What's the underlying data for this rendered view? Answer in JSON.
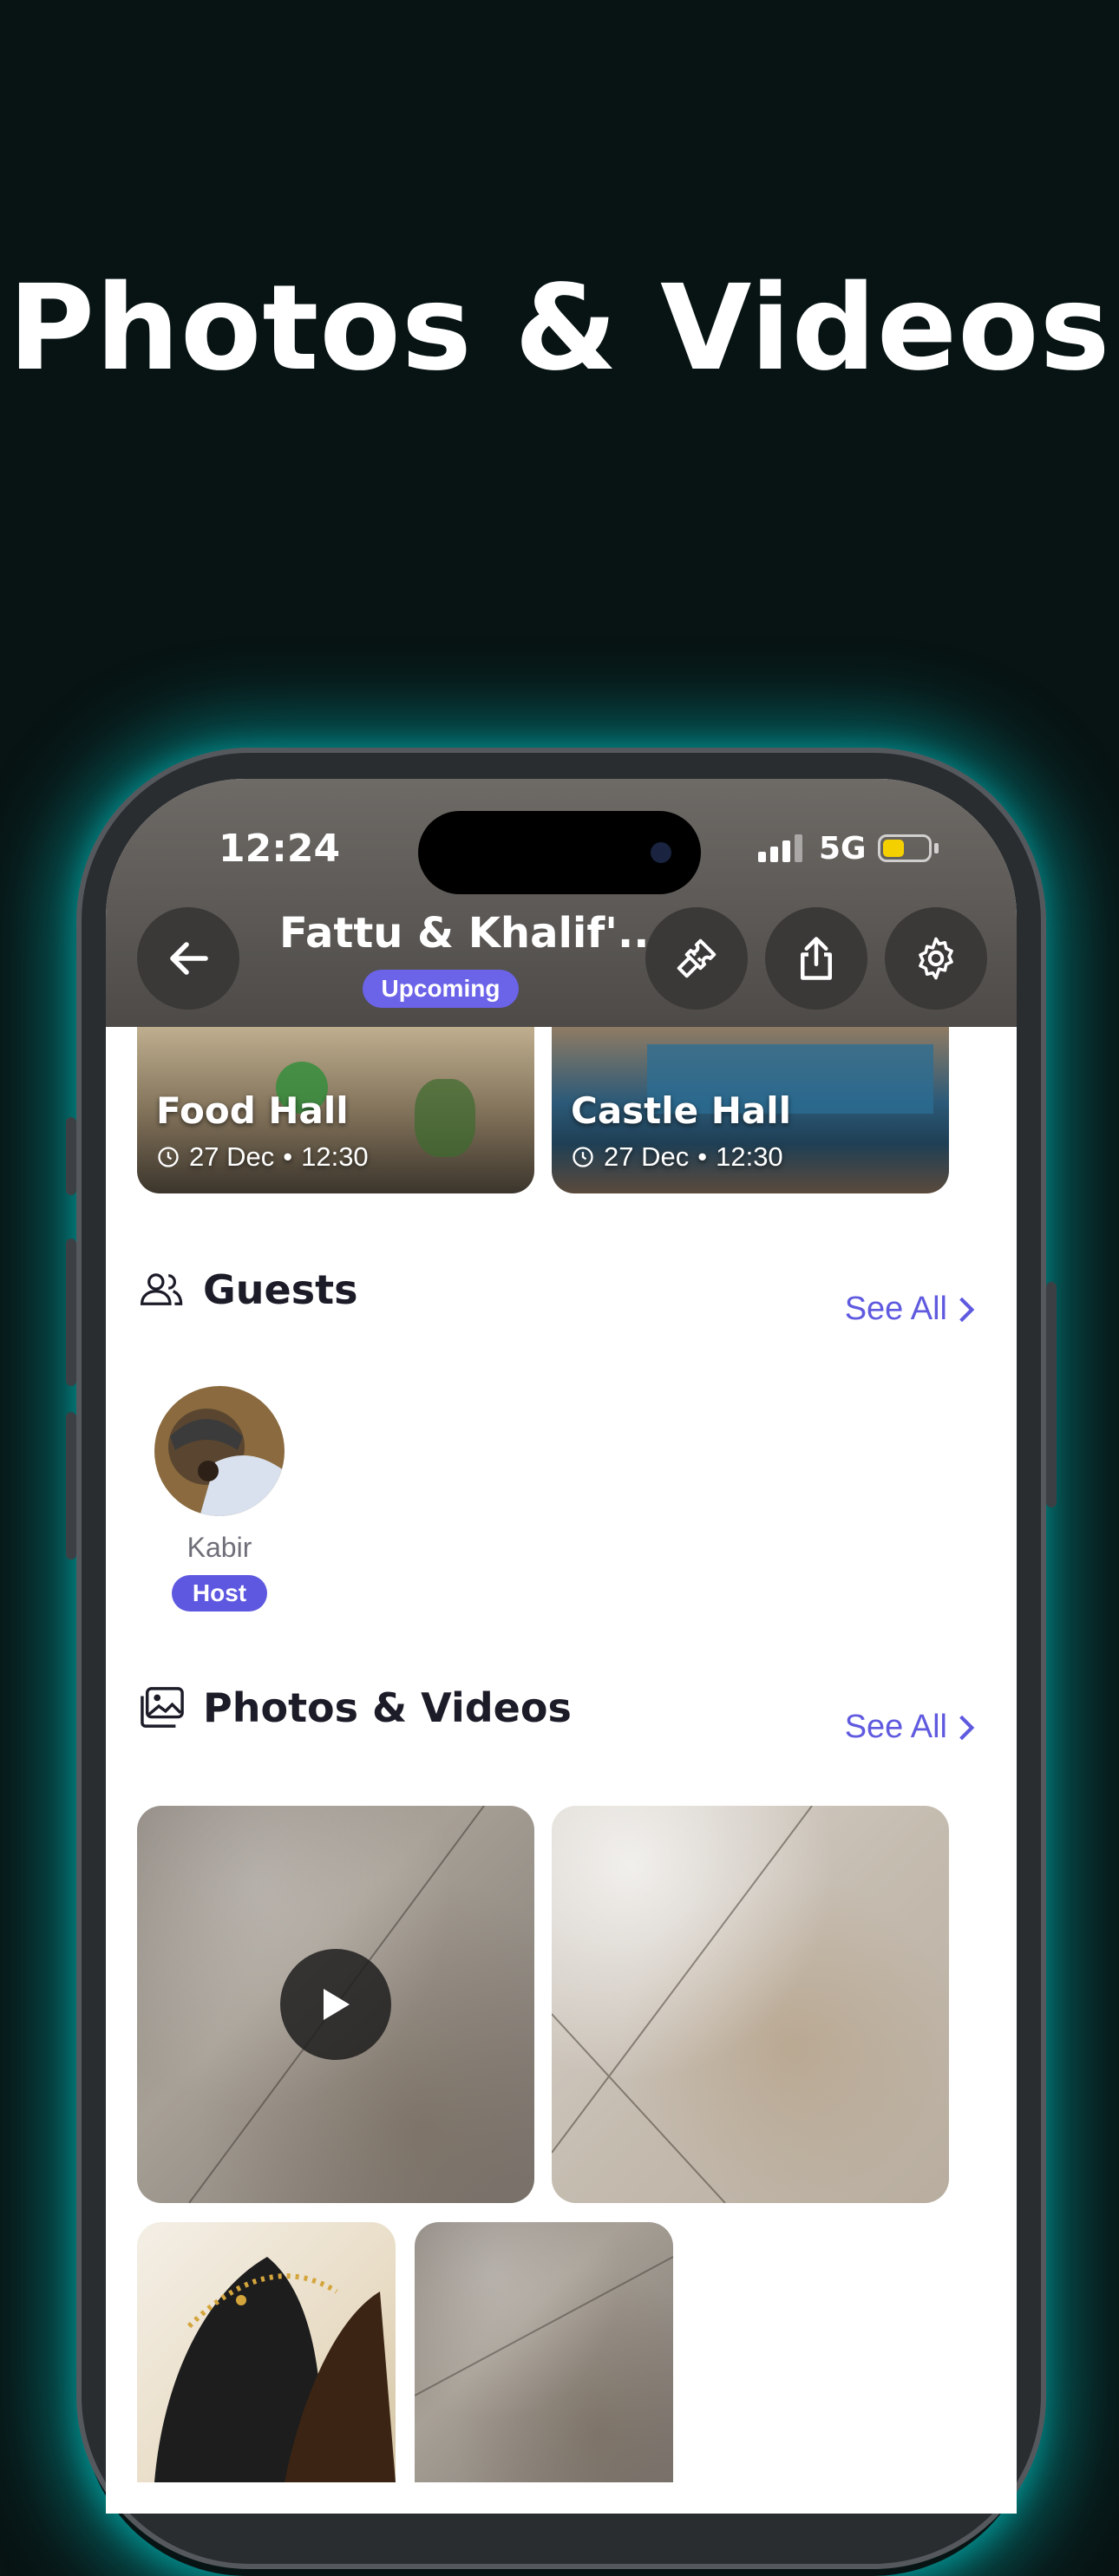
{
  "headline": "Photos & Videos",
  "status_bar": {
    "time": "12:24",
    "network": "5G"
  },
  "header": {
    "title": "Fattu & Khalif'...",
    "status_badge": "Upcoming"
  },
  "venues": [
    {
      "name": "Food Hall",
      "date": "27 Dec",
      "time": "12:30"
    },
    {
      "name": "Castle Hall",
      "date": "27 Dec",
      "time": "12:30"
    }
  ],
  "guests_section": {
    "title": "Guests",
    "see_all": "See All",
    "guests": [
      {
        "name": "Kabir",
        "role": "Host"
      }
    ]
  },
  "media_section": {
    "title": "Photos & Videos",
    "see_all": "See All"
  },
  "colors": {
    "accent": "#5f5adf",
    "background": "#081414",
    "glow": "#00c8c8"
  },
  "icons": [
    "back-arrow-icon",
    "ticket-icon",
    "share-icon",
    "gear-icon",
    "clock-icon",
    "users-icon",
    "image-icon",
    "chevron-right-icon",
    "play-icon"
  ]
}
